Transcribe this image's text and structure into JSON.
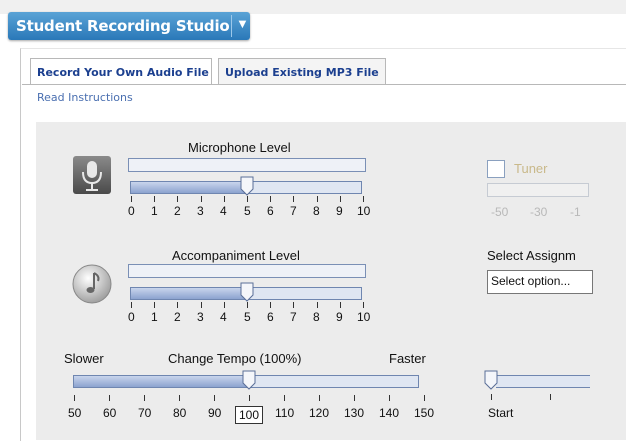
{
  "app": {
    "title": "Student Recording Studio"
  },
  "tabs": [
    {
      "label": "Record Your Own Audio File",
      "active": true
    },
    {
      "label": "Upload Existing MP3 File",
      "active": false
    }
  ],
  "read_instructions": "Read Instructions",
  "microphone": {
    "label": "Microphone Level",
    "value": 5,
    "scale": [
      "0",
      "1",
      "2",
      "3",
      "4",
      "5",
      "6",
      "7",
      "8",
      "9",
      "10"
    ]
  },
  "accompaniment": {
    "label": "Accompaniment Level",
    "value": 5,
    "scale": [
      "0",
      "1",
      "2",
      "3",
      "4",
      "5",
      "6",
      "7",
      "8",
      "9",
      "10"
    ]
  },
  "tempo": {
    "label": "Change Tempo (100%)",
    "slower": "Slower",
    "faster": "Faster",
    "value": 100,
    "scale": [
      "50",
      "60",
      "70",
      "80",
      "90",
      "100",
      "110",
      "120",
      "130",
      "140",
      "150"
    ]
  },
  "tuner": {
    "label": "Tuner",
    "checked": false,
    "scale": [
      "-50",
      "-30",
      "-1"
    ]
  },
  "assignment": {
    "label": "Select Assignm",
    "selected": "Select option..."
  },
  "position": {
    "label": "Start",
    "value": 0
  },
  "colors": {
    "title_bar": "#2a78b8",
    "tab_text": "#1b3f8f",
    "link": "#4a6fb0",
    "panel": "#ececec",
    "slider_fill": "#a9bce0"
  },
  "icons": {
    "microphone": "microphone-icon",
    "accompaniment": "music-note-icon",
    "dropdown": "chevron-down-icon"
  }
}
